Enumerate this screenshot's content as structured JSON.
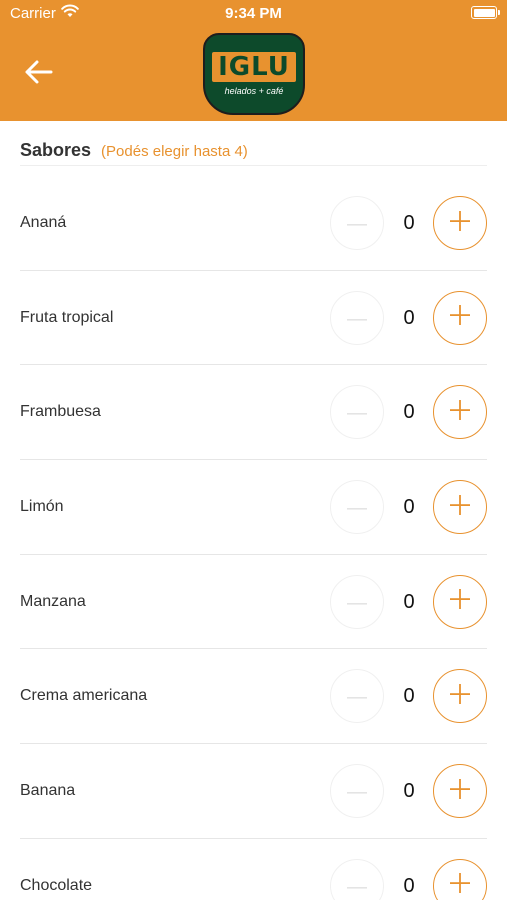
{
  "status_bar": {
    "carrier": "Carrier",
    "time": "9:34 PM"
  },
  "header": {
    "logo_word": "IGLU",
    "logo_tagline": "helados + café",
    "color": "#E8922F"
  },
  "section": {
    "title": "Sabores",
    "hint": "(Podés elegir hasta 4)"
  },
  "flavors": [
    {
      "name": "Ananá",
      "qty": "0"
    },
    {
      "name": "Fruta tropical",
      "qty": "0"
    },
    {
      "name": "Frambuesa",
      "qty": "0"
    },
    {
      "name": "Limón",
      "qty": "0"
    },
    {
      "name": "Manzana",
      "qty": "0"
    },
    {
      "name": "Crema americana",
      "qty": "0"
    },
    {
      "name": "Banana",
      "qty": "0"
    },
    {
      "name": "Chocolate",
      "qty": "0"
    }
  ],
  "icons": {
    "back": "back-arrow-icon",
    "minus": "minus-icon",
    "plus": "plus-icon"
  }
}
